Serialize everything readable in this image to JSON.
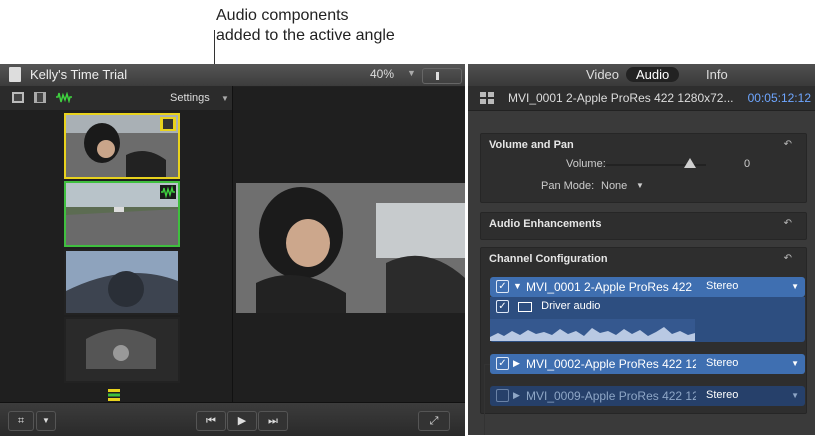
{
  "callouts": {
    "top": "Audio components\nadded to the active angle"
  },
  "viewer": {
    "title": "Kelly's Time Trial",
    "zoom": "40%",
    "settings_label": "Settings"
  },
  "inspector": {
    "tabs": [
      "Video",
      "Audio",
      "Info"
    ],
    "selected_tab": "Audio",
    "clip_name": "MVI_0001 2-Apple ProRes 422 1280x72...",
    "timecode": "00:05:12:12",
    "volume_pan": {
      "title": "Volume and Pan",
      "volume_label": "Volume:",
      "volume_value": "0",
      "pan_label": "Pan Mode:",
      "pan_value": "None"
    },
    "audio_enhancements": {
      "title": "Audio Enhancements"
    },
    "channel_config": {
      "title": "Channel Configuration",
      "components": [
        {
          "name": "MVI_0001 2-Apple ProRes 422 1",
          "format": "Stereo",
          "checked": true,
          "expanded": true
        },
        {
          "name": "MVI_0002-Apple ProRes 422 12",
          "format": "Stereo",
          "checked": true,
          "expanded": false
        },
        {
          "name": "MVI_0009-Apple ProRes 422 12",
          "format": "Stereo",
          "checked": false,
          "expanded": false
        }
      ],
      "sub_label": "Driver audio"
    }
  },
  "colors": {
    "active_video": "#e8d21d",
    "active_audio": "#3fbf3f",
    "component_blue": "#3f6fb1",
    "timecode": "#6ea6ff"
  }
}
